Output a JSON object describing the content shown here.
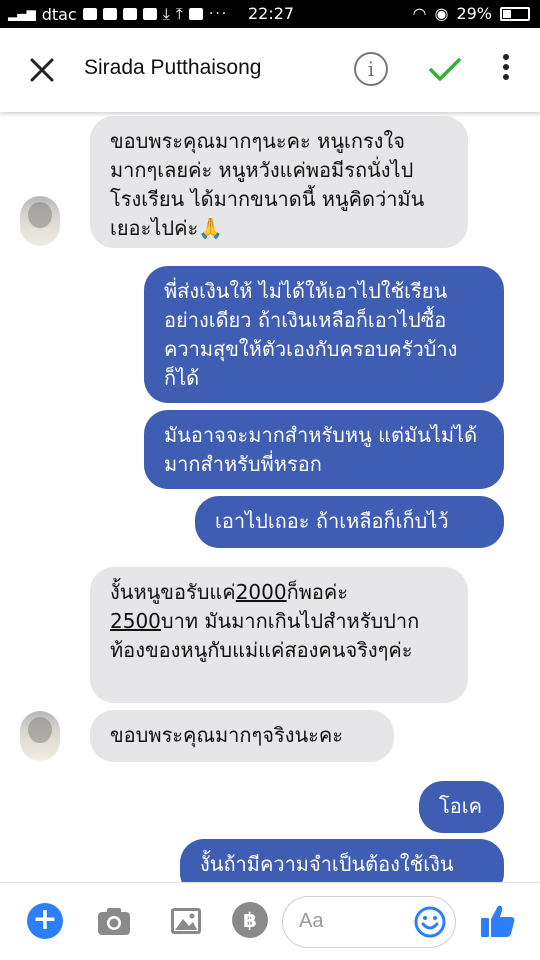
{
  "status_bar": {
    "carrier": "dtac",
    "time": "22:27",
    "battery": "29%",
    "dots": "···"
  },
  "header": {
    "title": "Sirada Putthaisong",
    "info_icon": "info-icon",
    "info_glyph": "i"
  },
  "messages": [
    {
      "from": "them",
      "text": "ขอบพระคุณมากๆนะคะ หนูเกรงใจมากๆเลยค่ะ หนูหวังแค่พอมีรถนั่งไปโรงเรียน ได้มากขนาดนี้ หนูคิดว่ามันเยอะไปค่ะ🙏"
    },
    {
      "from": "me",
      "text": "พี่ส่งเงินให้ ไม่ได้ให้เอาไปใช้เรียนอย่างเดียว ถ้าเงินเหลือก็เอาไปซื้อความสุขให้ตัวเองกับครอบครัวบ้างก็ได้"
    },
    {
      "from": "me",
      "text": "มันอาจจะมากสำหรับหนู แต่มันไม่ได้มากสำหรับพี่หรอก"
    },
    {
      "from": "me",
      "text": "เอาไปเถอะ ถ้าเหลือก็เก็บไว้"
    },
    {
      "from": "them",
      "parts": [
        "งั้นหนูขอรับแค่",
        "2000",
        "ก็พอค่ะ",
        "2500",
        "บาท มันมากเกินไปสำหรับปากท้องของหนูกับแม่แค่สองคนจริงๆค่ะ"
      ]
    },
    {
      "from": "them",
      "text": "ขอบพระคุณมากๆจริงนะคะ"
    },
    {
      "from": "me",
      "text": "โอเค"
    },
    {
      "from": "me",
      "text": "งั้นถ้ามีความจำเป็นต้องใช้เงิน"
    }
  ],
  "composer": {
    "placeholder": "Aa",
    "plus_label": "+",
    "currency_label": "฿"
  },
  "colors": {
    "outgoing_bubble": "#3f5db3",
    "incoming_bubble": "#e6e6e8",
    "accent_blue": "#2d7ff9",
    "check_green": "#34b233"
  }
}
